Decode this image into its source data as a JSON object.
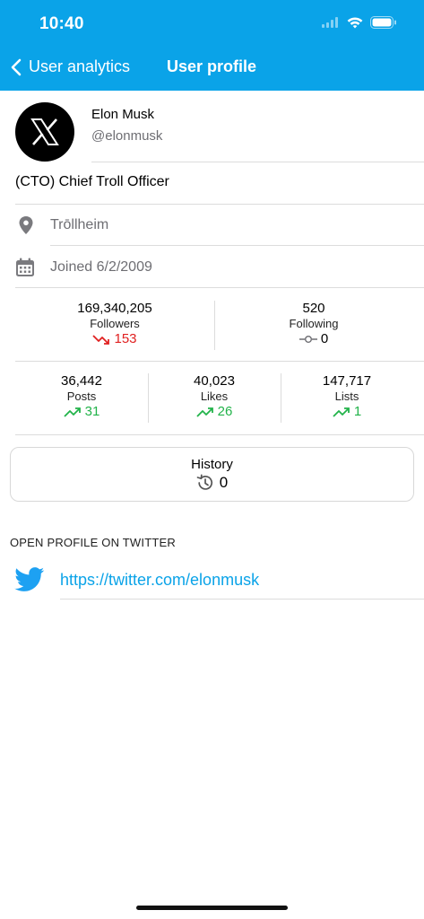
{
  "status_bar": {
    "time": "10:40"
  },
  "nav": {
    "back_label": "User analytics",
    "title": "User profile"
  },
  "profile": {
    "name": "Elon Musk",
    "handle": "@elonmusk",
    "bio": "(CTO) Chief Troll Officer",
    "location": "Trōllheim",
    "joined": "Joined 6/2/2009",
    "avatar_glyph": "X"
  },
  "stats_primary": [
    {
      "value": "169,340,205",
      "label": "Followers",
      "change": "153",
      "trend": "down"
    },
    {
      "value": "520",
      "label": "Following",
      "change": "0",
      "trend": "flat"
    }
  ],
  "stats_secondary": [
    {
      "value": "36,442",
      "label": "Posts",
      "change": "31",
      "trend": "up"
    },
    {
      "value": "40,023",
      "label": "Likes",
      "change": "26",
      "trend": "up"
    },
    {
      "value": "147,717",
      "label": "Lists",
      "change": "1",
      "trend": "up"
    }
  ],
  "history": {
    "label": "History",
    "count": "0"
  },
  "open_profile": {
    "section_title": "OPEN PROFILE ON TWITTER",
    "url": "https://twitter.com/elonmusk"
  },
  "colors": {
    "accent": "#0aa3e8",
    "down": "#e02020",
    "up": "#22b34a"
  }
}
